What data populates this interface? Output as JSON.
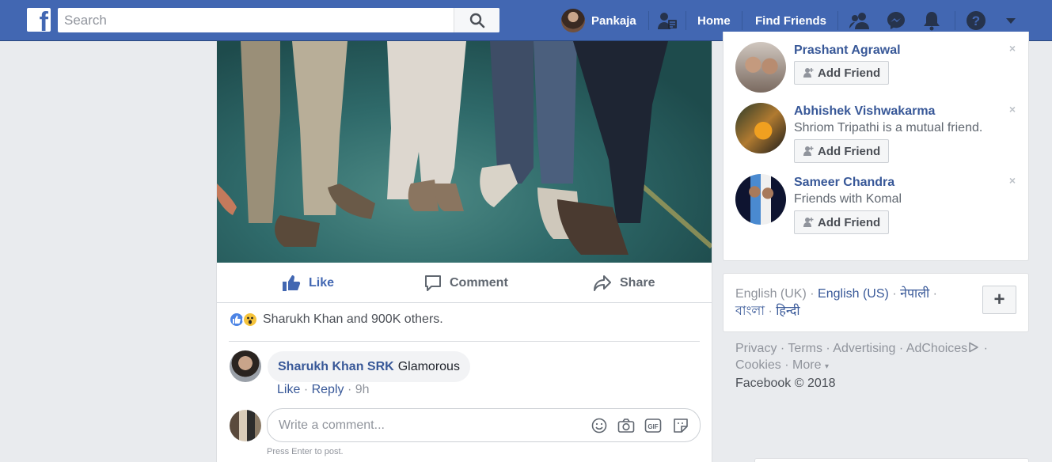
{
  "topbar": {
    "logo_letter": "f",
    "search_placeholder": "Search",
    "user_name": "Pankaja",
    "home_label": "Home",
    "find_friends_label": "Find Friends",
    "icons": [
      "search-icon",
      "find-friends-icon",
      "friend-requests-icon",
      "messenger-icon",
      "notifications-icon",
      "help-icon",
      "account-menu-icon"
    ],
    "bar_color": "#4267b2"
  },
  "post": {
    "actions": {
      "like": "Like",
      "comment": "Comment",
      "share": "Share"
    },
    "reactions_text": "Sharukh Khan and 900K others.",
    "comment": {
      "author": "Sharukh Khan SRK",
      "text": "Glamorous",
      "like": "Like",
      "reply": "Reply",
      "time": "9h"
    },
    "composer": {
      "placeholder": "Write a comment...",
      "hint": "Press Enter to post.",
      "icons": [
        "emoji-icon",
        "camera-icon",
        "gif-icon",
        "sticker-icon"
      ]
    }
  },
  "people_you_may_know": [
    {
      "name": "Prashant Agrawal",
      "subtitle": "",
      "button": "Add Friend",
      "close": "×"
    },
    {
      "name": "Abhishek Vishwakarma",
      "subtitle": "Shriom Tripathi is a mutual friend.",
      "button": "Add Friend",
      "close": "×"
    },
    {
      "name": "Sameer Chandra",
      "subtitle": "Friends with Komal",
      "button": "Add Friend",
      "close": "×"
    }
  ],
  "languages": {
    "current": "English (UK)",
    "others": [
      "English (US)",
      "नेपाली",
      "বাংলা",
      "हिन्दी"
    ],
    "sep": "·",
    "add_button": "+"
  },
  "footer": {
    "links": [
      "Privacy",
      "Terms",
      "Advertising",
      "AdChoices",
      "Cookies",
      "More"
    ],
    "more_caret": "▾",
    "copyright": "Facebook © 2018"
  }
}
